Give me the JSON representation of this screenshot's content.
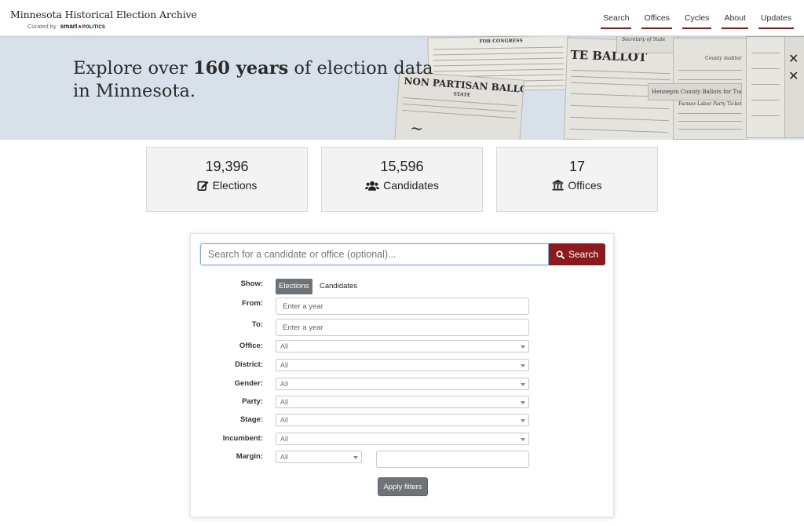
{
  "header": {
    "title": "Minnesota Historical Election Archive",
    "curated_by": "Curated by",
    "curator_brand": "smart",
    "curator_brand_suffix": "POLITICS",
    "nav": [
      {
        "label": "Search"
      },
      {
        "label": "Offices"
      },
      {
        "label": "Cycles"
      },
      {
        "label": "About"
      },
      {
        "label": "Updates"
      }
    ],
    "accent_color": "#8b1a1f"
  },
  "hero": {
    "title_pre": "Explore over ",
    "title_bold": "160 years",
    "title_post": " of election data in Minnesota.",
    "background_color": "#d8e1ea",
    "collage_texts": {
      "for_congress": "FOR CONGRESS",
      "state_ballot": "TE BALLOT",
      "non_partisan": "NON PARTISAN BALLOT",
      "state": "STATE",
      "county_auditor": "County Auditor",
      "secretary": "Secretary of State",
      "farmer_labor": "Farmer-Labor Party Ticket",
      "hennepin": "Hennepin County Ballots for Tuesday"
    }
  },
  "stats": [
    {
      "value": "19,396",
      "label": "Elections",
      "icon": "edit-icon"
    },
    {
      "value": "15,596",
      "label": "Candidates",
      "icon": "users-icon"
    },
    {
      "value": "17",
      "label": "Offices",
      "icon": "building-columns-icon"
    }
  ],
  "search": {
    "placeholder": "Search for a candidate or office (optional)...",
    "button_label": "Search",
    "show_label": "Show:",
    "show_options": [
      "Elections",
      "Candidates"
    ],
    "show_selected": "Elections",
    "from_label": "From:",
    "from_placeholder": "Enter a year",
    "to_label": "To:",
    "to_placeholder": "Enter a year",
    "office_label": "Office:",
    "office_value": "All",
    "district_label": "District:",
    "district_value": "All",
    "gender_label": "Gender:",
    "gender_value": "All",
    "party_label": "Party:",
    "party_value": "All",
    "stage_label": "Stage:",
    "stage_value": "All",
    "incumbent_label": "Incumbent:",
    "incumbent_value": "All",
    "margin_label": "Margin:",
    "margin_value": "All",
    "apply_label": "Apply filters"
  }
}
